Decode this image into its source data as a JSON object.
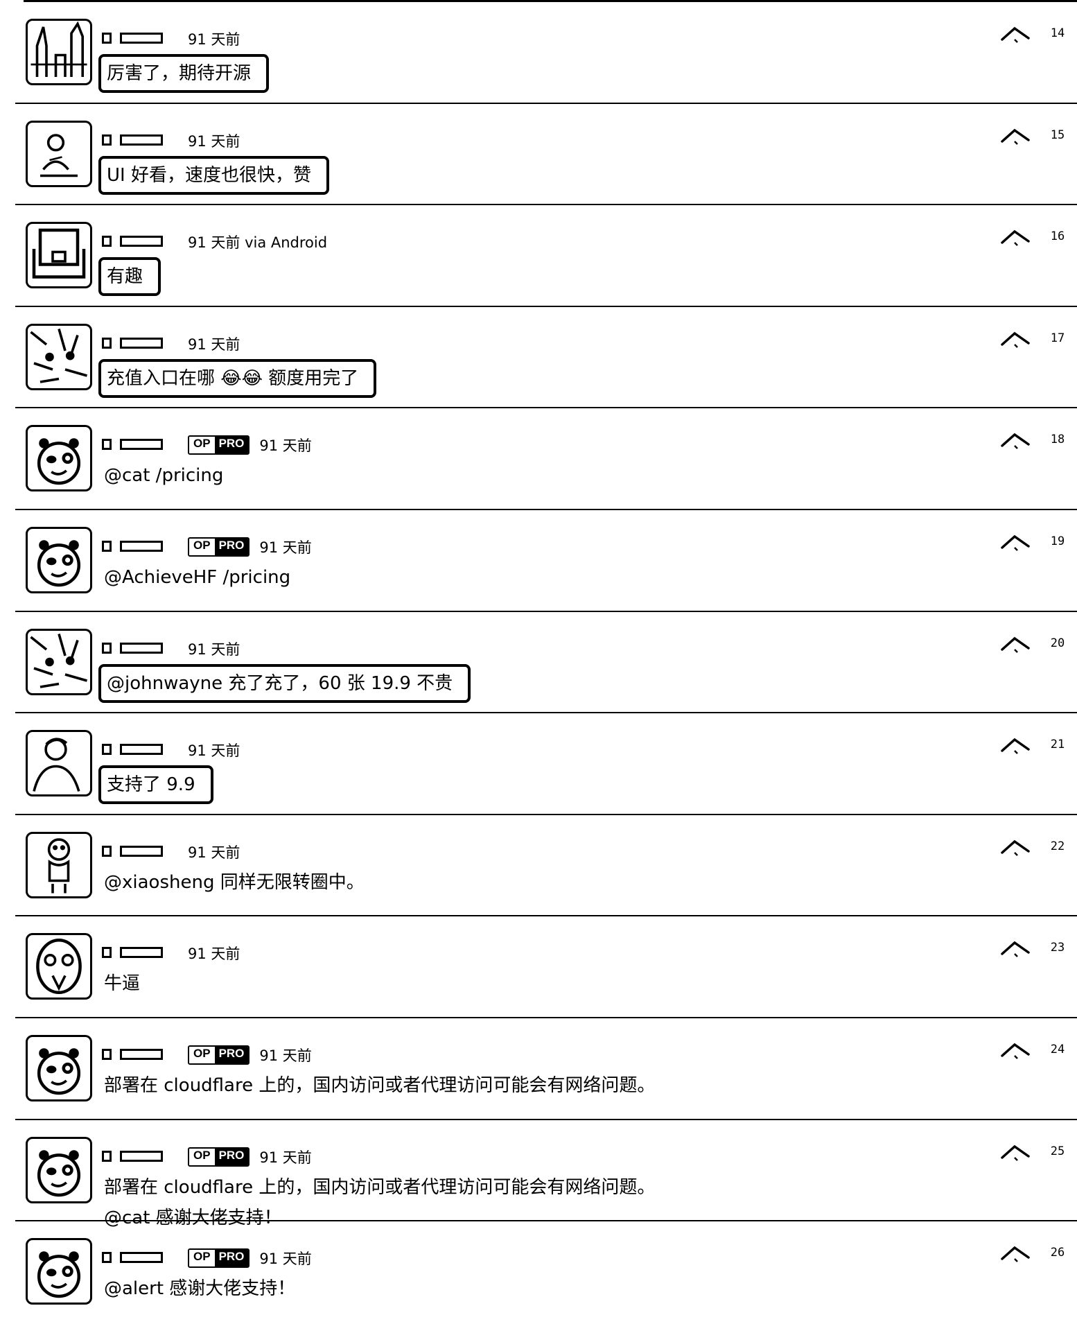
{
  "replies": [
    {
      "time": "91 天前",
      "content": [
        "厉害了，期待开源"
      ],
      "floor": "14",
      "boxed": true,
      "op": false,
      "avatar": "city-avatar"
    },
    {
      "time": "91 天前",
      "content": [
        "UI 好看，速度也很快，赞"
      ],
      "floor": "15",
      "boxed": true,
      "op": false,
      "avatar": "figure-avatar"
    },
    {
      "time": "91 天前 via Android",
      "content": [
        "有趣"
      ],
      "floor": "16",
      "boxed": true,
      "op": false,
      "avatar": "robot-avatar"
    },
    {
      "time": "91 天前",
      "content": [
        "充值入口在哪 😂😂 额度用完了"
      ],
      "floor": "17",
      "boxed": true,
      "op": false,
      "avatar": "cat-avatar"
    },
    {
      "time": "91 天前",
      "content": [
        "@cat /pricing"
      ],
      "floor": "18",
      "boxed": false,
      "op": true,
      "avatar": "panda-avatar"
    },
    {
      "time": "91 天前",
      "content": [
        "@AchieveHF /pricing"
      ],
      "floor": "19",
      "boxed": false,
      "op": true,
      "avatar": "panda-avatar"
    },
    {
      "time": "91 天前",
      "content": [
        "@johnwayne 充了充了，60 张 19.9 不贵"
      ],
      "floor": "20",
      "boxed": true,
      "op": false,
      "avatar": "cat-avatar"
    },
    {
      "time": "91 天前",
      "content": [
        "支持了 9.9"
      ],
      "floor": "21",
      "boxed": true,
      "op": false,
      "avatar": "person-avatar"
    },
    {
      "time": "91 天前",
      "content": [
        "@xiaosheng 同样无限转圈中。"
      ],
      "floor": "22",
      "boxed": false,
      "op": false,
      "avatar": "cartoon-avatar"
    },
    {
      "time": "91 天前",
      "content": [
        "牛逼"
      ],
      "floor": "23",
      "boxed": false,
      "op": false,
      "avatar": "face-avatar"
    },
    {
      "time": "91 天前",
      "content": [
        "部署在 cloudflare 上的，国内访问或者代理访问可能会有网络问题。"
      ],
      "floor": "24",
      "boxed": false,
      "op": true,
      "avatar": "panda-avatar"
    },
    {
      "time": "91 天前",
      "content": [
        "部署在 cloudflare 上的，国内访问或者代理访问可能会有网络问题。",
        "@cat 感谢大佬支持！"
      ],
      "floor": "25",
      "boxed": false,
      "op": true,
      "avatar": "panda-avatar"
    },
    {
      "time": "91 天前",
      "content": [
        "@alert 感谢大佬支持！"
      ],
      "floor": "26",
      "boxed": false,
      "op": true,
      "avatar": "panda-avatar"
    }
  ],
  "badge": {
    "op": "OP",
    "pro": "PRO"
  }
}
